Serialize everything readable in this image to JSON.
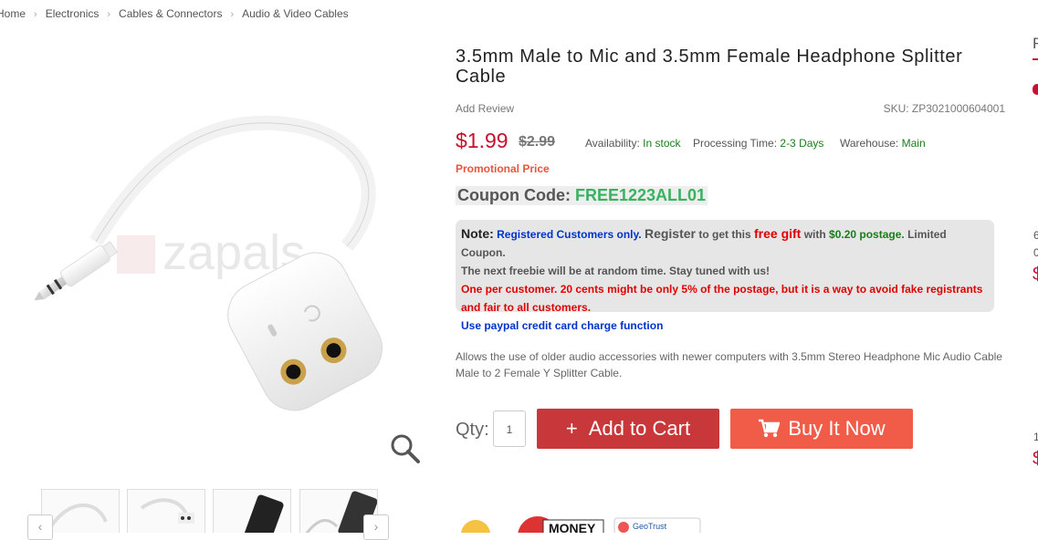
{
  "breadcrumb": {
    "items": [
      "Home",
      "Electronics",
      "Cables & Connectors",
      "Audio & Video Cables"
    ],
    "separator": ">"
  },
  "product": {
    "title": "3.5mm Male to Mic and 3.5mm Female Headphone Splitter Cable",
    "add_review": "Add Review",
    "sku": "SKU: ZP3021000604001",
    "price": "$1.99",
    "old_price": "$2.99",
    "availability_label": "Availability:",
    "availability_value": "In stock",
    "processing_label": "Processing Time:",
    "processing_value": "2-3 Days",
    "warehouse_label": "Warehouse:",
    "warehouse_value": "Main",
    "promo_label": "Promotional Price",
    "coupon_label": "Coupon Code:",
    "coupon_code": "FREE1223ALL01",
    "watermark": "zapals",
    "description": "Allows the use of older audio accessories with newer computers with 3.5mm Stereo Headphone Mic Audio Cable Male to 2 Female Y Splitter Cable."
  },
  "note": {
    "note_label": "Note:",
    "registered": "Registered Customers only.",
    "register": "Register",
    "to_get": "to get this",
    "free_gift": "free gift",
    "with": "with",
    "postage": "$0.20 postage.",
    "limited": "Limited Coupon.",
    "line2": "The next freebie will be at random time. Stay tuned with us!",
    "line3": "One per customer. 20 cents might be only 5% of the postage, but it is a way to avoid fake registrants and fair to all customers.",
    "line4": "Use paypal credit card charge function"
  },
  "purchase": {
    "qty_label": "Qty:",
    "qty_value": "1",
    "add_to_cart": "Add to Cart",
    "add_plus": "+",
    "buy_now": "Buy It Now"
  },
  "badges": {
    "money": "MONEY",
    "geotrust": "GeoTrust"
  },
  "right_column": {
    "top_letter": "F",
    "c1": "6",
    "c2": "0",
    "c3": "$",
    "c4": "1",
    "c5": "$"
  },
  "colors": {
    "price": "#c8102e",
    "add_to_cart_bg": "#c8383b",
    "buy_now_bg": "#f05c48",
    "coupon_code": "#35b35f",
    "in_stock": "#1a7d1a"
  },
  "icons": [
    "chevron-right-icon",
    "magnifier-icon",
    "cart-icon",
    "arrow-left-icon",
    "arrow-right-icon"
  ]
}
